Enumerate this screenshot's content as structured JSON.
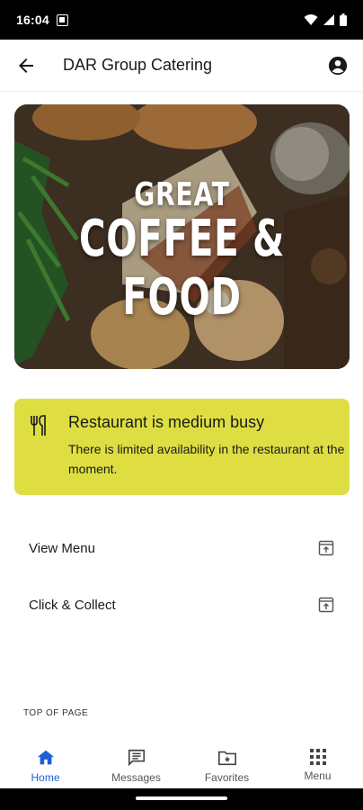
{
  "status_bar": {
    "time": "16:04"
  },
  "app_bar": {
    "title": "DAR Group Catering"
  },
  "hero": {
    "line1": "GREAT",
    "line2": "COFFEE & FOOD"
  },
  "busy_card": {
    "heading": "Restaurant is medium busy",
    "description": "There is limited availability in the restaurant at the moment.",
    "color": "#dede42"
  },
  "links": [
    {
      "label": "View Menu",
      "icon": "open-external-icon"
    },
    {
      "label": "Click & Collect",
      "icon": "open-external-icon"
    }
  ],
  "footer": {
    "top_of_page": "TOP OF PAGE"
  },
  "bottom_nav": {
    "items": [
      {
        "label": "Home",
        "icon": "home-icon",
        "active": true
      },
      {
        "label": "Messages",
        "icon": "message-icon",
        "active": false
      },
      {
        "label": "Favorites",
        "icon": "folder-star-icon",
        "active": false
      },
      {
        "label": "Menu",
        "icon": "grid-icon",
        "active": false
      }
    ],
    "active_color": "#1f5fd6"
  }
}
